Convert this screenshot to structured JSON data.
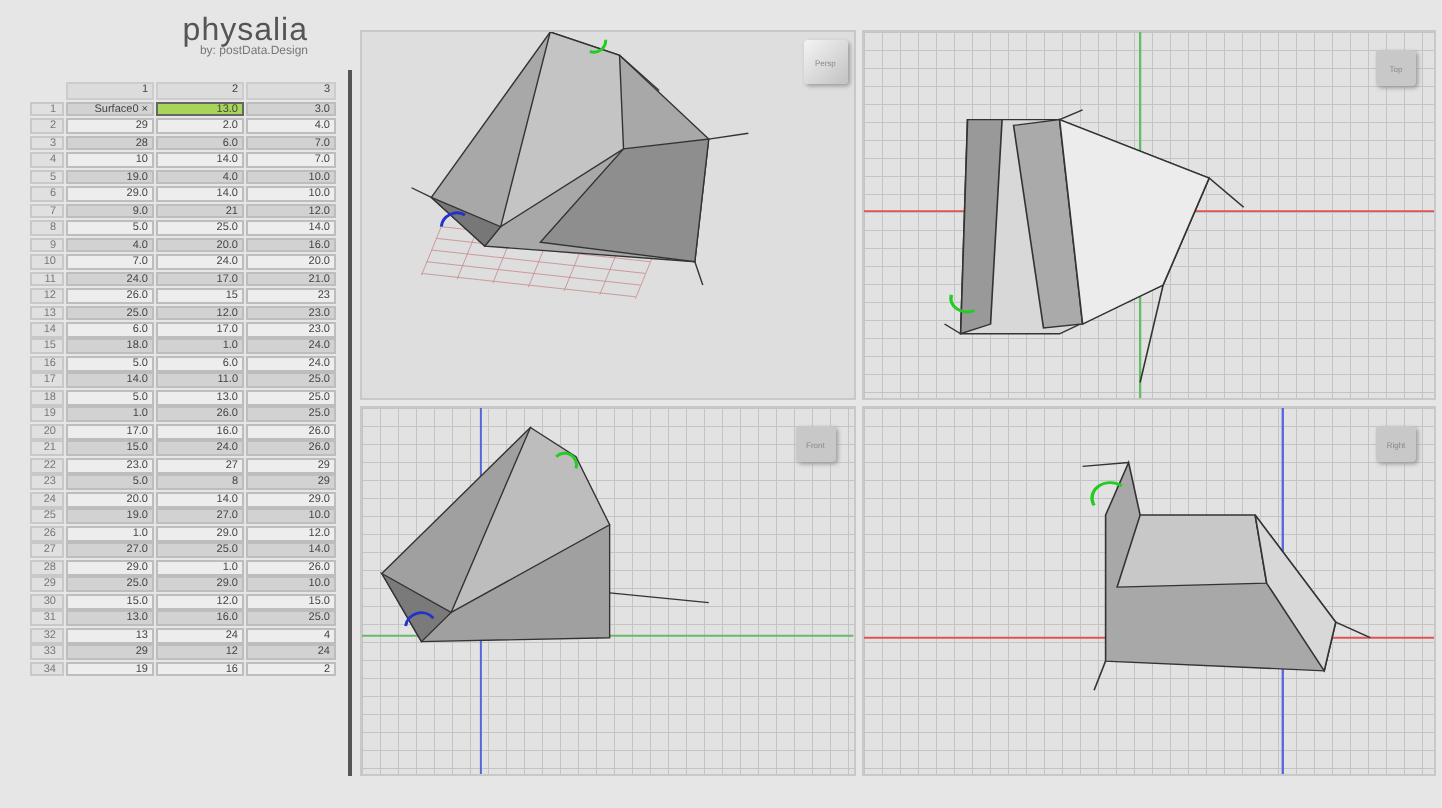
{
  "app": {
    "title": "physalia",
    "subtitle": "by: postData.Design"
  },
  "table": {
    "columns": [
      "1",
      "2",
      "3"
    ],
    "rows": [
      {
        "index": "1",
        "cells": [
          {
            "text": "Surface0 ×",
            "selected": false
          },
          {
            "text": "13.0",
            "selected": true
          },
          {
            "text": "3.0",
            "selected": false
          }
        ]
      },
      {
        "index": "2",
        "cells": [
          {
            "text": "29",
            "selected": false
          },
          {
            "text": "2.0",
            "selected": false
          },
          {
            "text": "4.0",
            "selected": false
          }
        ]
      },
      {
        "index": "3",
        "cells": [
          {
            "text": "28",
            "selected": false
          },
          {
            "text": "6.0",
            "selected": false
          },
          {
            "text": "7.0",
            "selected": false
          }
        ]
      },
      {
        "index": "4",
        "cells": [
          {
            "text": "10",
            "selected": false
          },
          {
            "text": "14.0",
            "selected": false
          },
          {
            "text": "7.0",
            "selected": false
          }
        ]
      },
      {
        "index": "5",
        "cells": [
          {
            "text": "19.0",
            "selected": false
          },
          {
            "text": "4.0",
            "selected": false
          },
          {
            "text": "10.0",
            "selected": false
          }
        ]
      },
      {
        "index": "6",
        "cells": [
          {
            "text": "29.0",
            "selected": false
          },
          {
            "text": "14.0",
            "selected": false
          },
          {
            "text": "10.0",
            "selected": false
          }
        ]
      },
      {
        "index": "7",
        "cells": [
          {
            "text": "9.0",
            "selected": false
          },
          {
            "text": "21",
            "selected": false
          },
          {
            "text": "12.0",
            "selected": false
          }
        ]
      },
      {
        "index": "8",
        "cells": [
          {
            "text": "5.0",
            "selected": false
          },
          {
            "text": "25.0",
            "selected": false
          },
          {
            "text": "14.0",
            "selected": false
          }
        ]
      },
      {
        "index": "9",
        "cells": [
          {
            "text": "4.0",
            "selected": false
          },
          {
            "text": "20.0",
            "selected": false
          },
          {
            "text": "16.0",
            "selected": false
          }
        ]
      },
      {
        "index": "10",
        "cells": [
          {
            "text": "7.0",
            "selected": false
          },
          {
            "text": "24.0",
            "selected": false
          },
          {
            "text": "20.0",
            "selected": false
          }
        ]
      },
      {
        "index": "11",
        "cells": [
          {
            "text": "24.0",
            "selected": false
          },
          {
            "text": "17.0",
            "selected": false
          },
          {
            "text": "21.0",
            "selected": false
          }
        ]
      },
      {
        "index": "12",
        "cells": [
          {
            "text": "26.0",
            "selected": false
          },
          {
            "text": "15",
            "selected": false
          },
          {
            "text": "23",
            "selected": false
          }
        ]
      },
      {
        "index": "13",
        "cells": [
          {
            "text": "25.0",
            "selected": false
          },
          {
            "text": "12.0",
            "selected": false
          },
          {
            "text": "23.0",
            "selected": false
          }
        ]
      },
      {
        "index": "14",
        "cells": [
          {
            "text": "6.0",
            "selected": false
          },
          {
            "text": "17.0",
            "selected": false
          },
          {
            "text": "23.0",
            "selected": false
          }
        ]
      },
      {
        "index": "15",
        "cells": [
          {
            "text": "18.0",
            "selected": false
          },
          {
            "text": "1.0",
            "selected": false
          },
          {
            "text": "24.0",
            "selected": false
          }
        ]
      },
      {
        "index": "16",
        "cells": [
          {
            "text": "5.0",
            "selected": false
          },
          {
            "text": "6.0",
            "selected": false
          },
          {
            "text": "24.0",
            "selected": false
          }
        ]
      },
      {
        "index": "17",
        "cells": [
          {
            "text": "14.0",
            "selected": false
          },
          {
            "text": "11.0",
            "selected": false
          },
          {
            "text": "25.0",
            "selected": false
          }
        ]
      },
      {
        "index": "18",
        "cells": [
          {
            "text": "5.0",
            "selected": false
          },
          {
            "text": "13.0",
            "selected": false
          },
          {
            "text": "25.0",
            "selected": false
          }
        ]
      },
      {
        "index": "19",
        "cells": [
          {
            "text": "1.0",
            "selected": false
          },
          {
            "text": "26.0",
            "selected": false
          },
          {
            "text": "25.0",
            "selected": false
          }
        ]
      },
      {
        "index": "20",
        "cells": [
          {
            "text": "17.0",
            "selected": false
          },
          {
            "text": "16.0",
            "selected": false
          },
          {
            "text": "26.0",
            "selected": false
          }
        ]
      },
      {
        "index": "21",
        "cells": [
          {
            "text": "15.0",
            "selected": false
          },
          {
            "text": "24.0",
            "selected": false
          },
          {
            "text": "26.0",
            "selected": false
          }
        ]
      },
      {
        "index": "22",
        "cells": [
          {
            "text": "23.0",
            "selected": false
          },
          {
            "text": "27",
            "selected": false
          },
          {
            "text": "29",
            "selected": false
          }
        ]
      },
      {
        "index": "23",
        "cells": [
          {
            "text": "5.0",
            "selected": false
          },
          {
            "text": "8",
            "selected": false
          },
          {
            "text": "29",
            "selected": false
          }
        ]
      },
      {
        "index": "24",
        "cells": [
          {
            "text": "20.0",
            "selected": false
          },
          {
            "text": "14.0",
            "selected": false
          },
          {
            "text": "29.0",
            "selected": false
          }
        ]
      },
      {
        "index": "25",
        "cells": [
          {
            "text": "19.0",
            "selected": false
          },
          {
            "text": "27.0",
            "selected": false
          },
          {
            "text": "10.0",
            "selected": false
          }
        ]
      },
      {
        "index": "26",
        "cells": [
          {
            "text": "1.0",
            "selected": false
          },
          {
            "text": "29.0",
            "selected": false
          },
          {
            "text": "12.0",
            "selected": false
          }
        ]
      },
      {
        "index": "27",
        "cells": [
          {
            "text": "27.0",
            "selected": false
          },
          {
            "text": "25.0",
            "selected": false
          },
          {
            "text": "14.0",
            "selected": false
          }
        ]
      },
      {
        "index": "28",
        "cells": [
          {
            "text": "29.0",
            "selected": false
          },
          {
            "text": "1.0",
            "selected": false
          },
          {
            "text": "26.0",
            "selected": false
          }
        ]
      },
      {
        "index": "29",
        "cells": [
          {
            "text": "25.0",
            "selected": false
          },
          {
            "text": "29.0",
            "selected": false
          },
          {
            "text": "10.0",
            "selected": false
          }
        ]
      },
      {
        "index": "30",
        "cells": [
          {
            "text": "15.0",
            "selected": false
          },
          {
            "text": "12.0",
            "selected": false
          },
          {
            "text": "15.0",
            "selected": false
          }
        ]
      },
      {
        "index": "31",
        "cells": [
          {
            "text": "13.0",
            "selected": false
          },
          {
            "text": "16.0",
            "selected": false
          },
          {
            "text": "25.0",
            "selected": false
          }
        ]
      },
      {
        "index": "32",
        "cells": [
          {
            "text": "13",
            "selected": false
          },
          {
            "text": "24",
            "selected": false
          },
          {
            "text": "4",
            "selected": false
          }
        ]
      },
      {
        "index": "33",
        "cells": [
          {
            "text": "29",
            "selected": false
          },
          {
            "text": "12",
            "selected": false
          },
          {
            "text": "24",
            "selected": false
          }
        ]
      },
      {
        "index": "34",
        "cells": [
          {
            "text": "19",
            "selected": false
          },
          {
            "text": "16",
            "selected": false
          },
          {
            "text": "2",
            "selected": false
          }
        ]
      }
    ]
  },
  "viewports": [
    {
      "label": "Persp",
      "kind": "perspective"
    },
    {
      "label": "Top",
      "kind": "top"
    },
    {
      "label": "Front",
      "kind": "front"
    },
    {
      "label": "Right",
      "kind": "right"
    }
  ]
}
